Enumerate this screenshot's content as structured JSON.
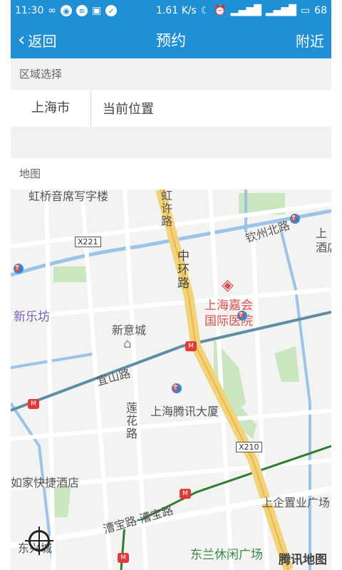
{
  "status": {
    "time": "11:30",
    "speed": "1.61 K/s",
    "battery": "68"
  },
  "nav": {
    "back_label": "返回",
    "title": "预约",
    "nearby_label": "附近"
  },
  "region": {
    "section_label": "区域选择",
    "city": "上海市",
    "location": "当前位置"
  },
  "map": {
    "section_label": "地图",
    "labels": {
      "hongqiao_school": "虹桥音席写字楼",
      "xinyi_city": "新意城",
      "shanghai_jiahui": "上海嘉会",
      "jiahui_hospital": "国际医院",
      "xinlefang": "新乐坊",
      "tencent_building": "上海腾讯大厦",
      "yishan_road": "宜山路",
      "zhonghuan_road": "中环路",
      "hongxu_road": "虹许路",
      "qinzhou_north": "钦州北路",
      "lianhua_road": "莲花路",
      "caobao_road": "漕宝路·漕宝路",
      "home_inn": "如家快捷酒店",
      "shangqi_plaza": "上企置业广场",
      "donglan_plaza": "东兰休闲广场",
      "dongxing_city": "东兴城",
      "hotel_partial": "上\n酒店"
    },
    "road_tags": {
      "x221": "X221",
      "x210": "X210"
    },
    "watermark": "腾讯地图"
  },
  "colors": {
    "accent": "#1f8fd6"
  }
}
